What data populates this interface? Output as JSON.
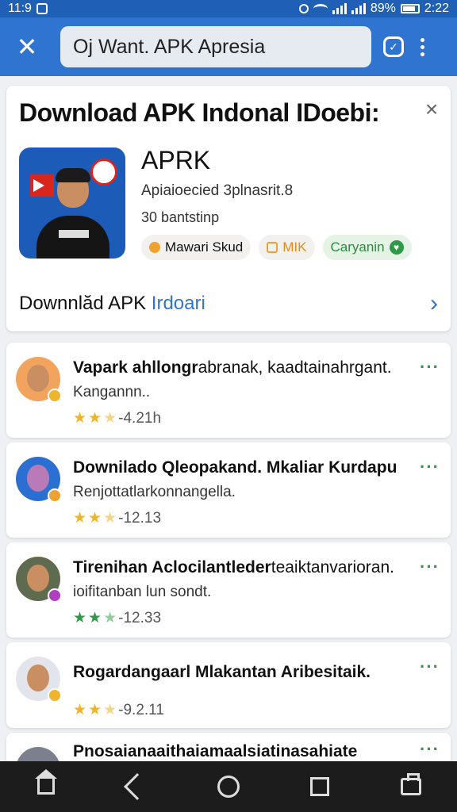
{
  "status_bar": {
    "time": "11:9",
    "battery": "89%",
    "clock_right": "2:22"
  },
  "search": {
    "value": "Oj Want. APK Apresia"
  },
  "app": {
    "card_title": "Download APK Indonal IDoebi:",
    "name": "APRK",
    "developer": "Apiaioecied 3plnasrit.8",
    "installs": "30 bantstinp",
    "chips": [
      {
        "label": "Mawari Skud",
        "icon_color": "#f0a22e"
      },
      {
        "label": "MIK",
        "icon_color": "#f0a22e"
      },
      {
        "label": "Caryanin",
        "icon_color": "#2e9a45"
      }
    ],
    "download_prefix": "Downnlăd APK ",
    "download_highlight": "Irdoari"
  },
  "reviews": [
    {
      "name": "Vapark ahllongr",
      "name_rest": "abranak, kaadtainahrgant.",
      "text": "Kangannn..",
      "rating": 2.5,
      "meta": "-4.21h",
      "star_color": "#f0b429",
      "avatar_bg": "#f2a35e",
      "badge_color": "#f0b429"
    },
    {
      "name": "Downilado Qleopakand. Mkaliar Kurdapu",
      "name_rest": "",
      "text": "Renjottatlarkonnangella.",
      "rating": 2.5,
      "meta": "-12.13",
      "star_color": "#f0b429",
      "avatar_bg": "#2a6fd1",
      "badge_color": "#f0a22e"
    },
    {
      "name": "Tirenihan Aclocilantleder",
      "name_rest": "teaiktanvarioran.",
      "text": "ioifitanban lun sondt.",
      "rating": 2.5,
      "meta": "-12.33",
      "star_color": "#2e9a45",
      "avatar_bg": "#5f6b4e",
      "badge_color": "#b03dc2"
    },
    {
      "name": "Rogardangaarl Mlakantan Aribesitaik.",
      "name_rest": "",
      "text": "",
      "rating": 2.5,
      "meta": "-9.2.11",
      "star_color": "#f0b429",
      "avatar_bg": "#e3e5ec",
      "badge_color": "#f0b429"
    },
    {
      "name": "Pnosaianaaithaiamaalsiatinasahiate",
      "name_rest": "",
      "text": "",
      "rating": 0,
      "meta": "",
      "star_color": "#f0b429",
      "avatar_bg": "#7b7f8e",
      "badge_color": "#f0b429"
    }
  ]
}
